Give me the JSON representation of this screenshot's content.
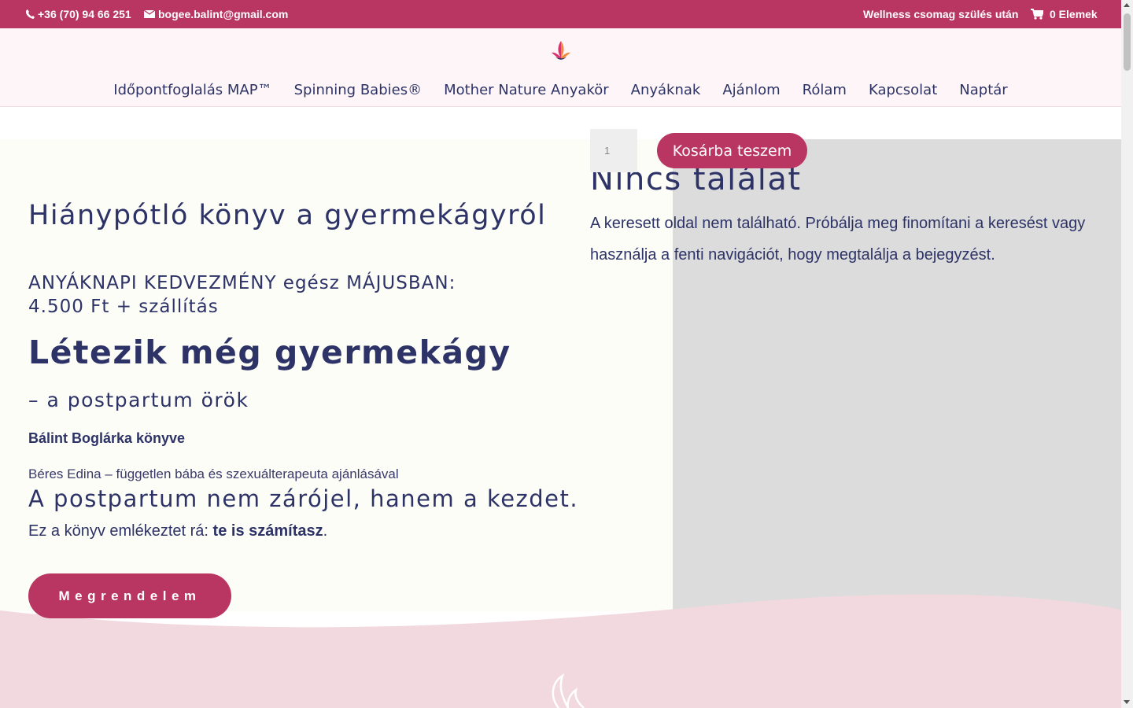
{
  "topbar": {
    "phone": "+36 (70) 94 66 251",
    "email": "bogee.balint@gmail.com",
    "wellness_link": "Wellness csomag szülés után",
    "cart_label": "0 Elemek"
  },
  "nav": {
    "items": [
      "Időpontfoglalás MAP™",
      "Spinning Babies®",
      "Mother Nature Anyakör",
      "Anyáknak",
      "Ajánlom",
      "Rólam",
      "Kapcsolat",
      "Naptár"
    ]
  },
  "hero": {
    "title": "Hiánypótló könyv a gyermekágyról",
    "discount_line1": "ANYÁKNAPI KEDVEZMÉNY egész MÁJUSBAN:",
    "discount_line2": "4.500 Ft + szállítás",
    "big_title": "Létezik még gyermekágy",
    "subtitle": "– a postpartum örök",
    "author": "Bálint Boglárka könyve",
    "recommendation": "Béres Edina – független bába és szexuálterapeuta ajánlásával",
    "postpartum": "A postpartum nem zárójel, hanem a kezdet.",
    "remind_prefix": "Ez a könyv emlékeztet rá: ",
    "remind_bold": "te is számítasz",
    "remind_suffix": ".",
    "order_button": "Megrendelem"
  },
  "product": {
    "quantity": "1",
    "add_to_cart": "Kosárba teszem"
  },
  "not_found": {
    "title": "Nincs találat",
    "text": "A keresett oldal nem található. Próbálja meg finomítani a keresést vagy használja a fenti navigációt, hogy megtalálja a bejegyzést."
  },
  "colors": {
    "brand": "#b93562",
    "navy": "#2d3366",
    "header_bg": "#fdf5f8",
    "pink_wave": "#f1d9df"
  }
}
